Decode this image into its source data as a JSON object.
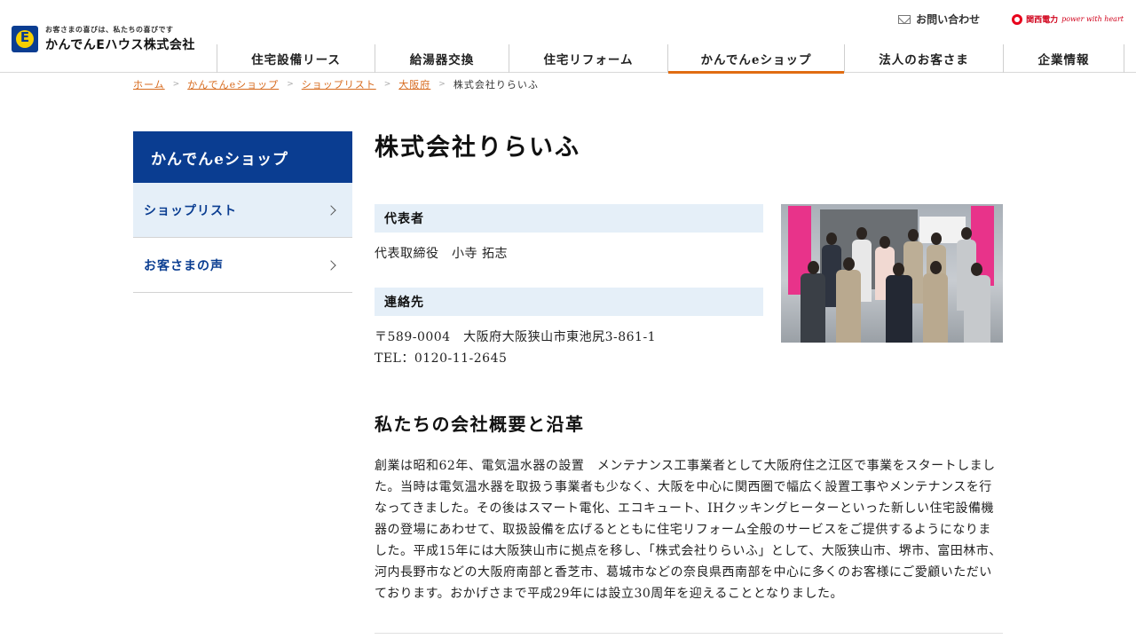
{
  "header": {
    "logo_tagline": "お客さまの喜びは、私たちの喜びです",
    "logo_name": "かんでんEハウス株式会社",
    "logo_mark": "E",
    "contact_label": "お問い合わせ",
    "kepco_name": "関西電力",
    "kepco_slogan": "power with heart"
  },
  "nav": {
    "items": [
      {
        "label": "住宅設備リース"
      },
      {
        "label": "給湯器交換"
      },
      {
        "label": "住宅リフォーム"
      },
      {
        "label": "かんでんeショップ"
      },
      {
        "label": "法人のお客さま"
      },
      {
        "label": "企業情報"
      }
    ],
    "active_index": 3,
    "accent_color": "#e06c12"
  },
  "breadcrumb": {
    "items": [
      "ホーム",
      "かんでんeショップ",
      "ショップリスト",
      "大阪府"
    ],
    "current": "株式会社りらいふ"
  },
  "sidebar": {
    "title": "かんでんeショップ",
    "items": [
      {
        "label": "ショップリスト"
      },
      {
        "label": "お客さまの声"
      }
    ],
    "brand_color": "#0a3d91"
  },
  "main": {
    "title": "株式会社りらいふ",
    "representative_heading": "代表者",
    "representative": "代表取締役　小寺 拓志",
    "contact_heading": "連絡先",
    "address": "〒589-0004　大阪府大阪狭山市東池尻3-861-1",
    "tel": "TEL：0120-11-2645",
    "history_heading": "私たちの会社概要と沿革",
    "history_text": "創業は昭和62年、電気温水器の設置　メンテナンス工事業者として大阪府住之江区で事業をスタートしました。当時は電気温水器を取扱う事業者も少なく、大阪を中心に関西圏で幅広く設置工事やメンテナンスを行なってきました。その後はスマート電化、エコキュート、IHクッキングヒーターといった新しい住宅設備機器の登場にあわせて、取扱設備を広げるとともに住宅リフォーム全般のサービスをご提供するようになりました。平成15年には大阪狭山市に拠点を移し、「株式会社りらいふ」として、大阪狭山市、堺市、富田林市、河内長野市などの大阪府南部と香芝市、葛城市などの奈良県西南部を中心に多くのお客様にご愛顧いただいております。おかげさまで平成29年には設立30周年を迎えることとなりました。"
  }
}
